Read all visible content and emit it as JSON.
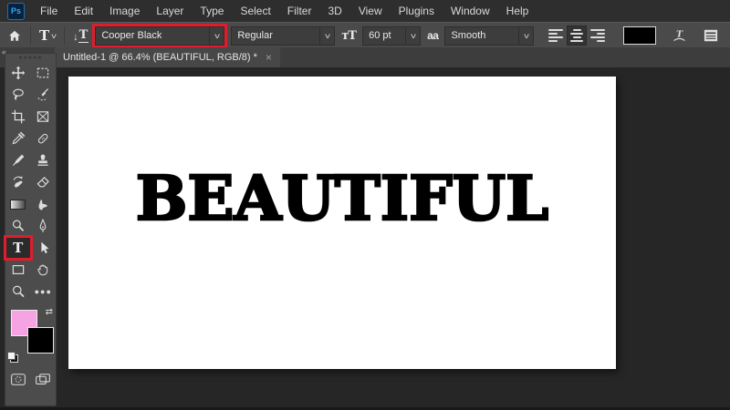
{
  "menubar": {
    "logo": "Ps",
    "items": [
      "File",
      "Edit",
      "Image",
      "Layer",
      "Type",
      "Select",
      "Filter",
      "3D",
      "View",
      "Plugins",
      "Window",
      "Help"
    ]
  },
  "options_bar": {
    "font_family": "Cooper Black",
    "font_style": "Regular",
    "font_size": "60 pt",
    "anti_alias": "Smooth"
  },
  "icons": {
    "type_tool": "T",
    "chevron": "v",
    "orientation_arrow": "↓",
    "orientation_letter": "T",
    "size_icon": "ᴛT",
    "anti_alias_icon": "aa",
    "ellipsis": "●●●",
    "collapse": "«",
    "swap": "⇄",
    "handle_dots": "●●●●●"
  },
  "document_tab": {
    "title": "Untitled-1 @ 66.4% (BEAUTIFUL, RGB/8) *",
    "close": "×"
  },
  "toolbar": {
    "tools": [
      "move",
      "marquee",
      "lasso",
      "quick-selection",
      "crop",
      "frame",
      "eyedropper",
      "healing-brush",
      "brush",
      "clone-stamp",
      "history-brush",
      "eraser",
      "gradient",
      "smudge",
      "dodge",
      "pen",
      "type",
      "path-selection",
      "rectangle",
      "hand",
      "zoom",
      "edit-toolbar"
    ]
  },
  "canvas": {
    "text": "BEAUTIFUL"
  },
  "colors": {
    "foreground_swatch": "#f6a3e4",
    "background_swatch": "#000000",
    "highlight_red": "#e01d2c",
    "canvas_background": "#ffffff",
    "canvas_text": "#000000"
  }
}
